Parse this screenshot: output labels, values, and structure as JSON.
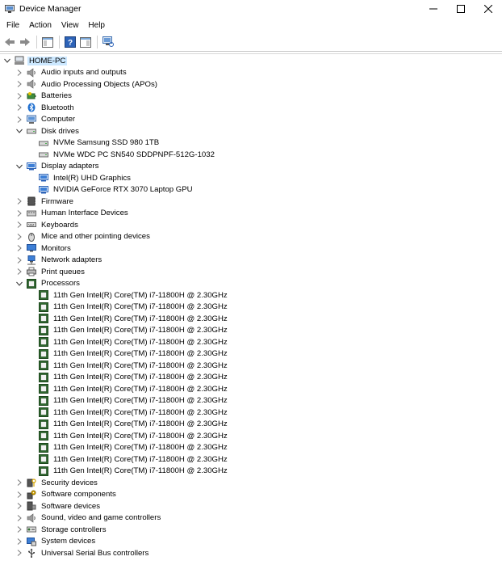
{
  "window": {
    "title": "Device Manager"
  },
  "menu": [
    "File",
    "Action",
    "View",
    "Help"
  ],
  "tree": {
    "root": "HOME-PC",
    "categories": [
      {
        "label": "Audio inputs and outputs",
        "icon": "speaker-icon",
        "expanded": false
      },
      {
        "label": "Audio Processing Objects (APOs)",
        "icon": "speaker-icon",
        "expanded": false
      },
      {
        "label": "Batteries",
        "icon": "battery-icon",
        "expanded": false
      },
      {
        "label": "Bluetooth",
        "icon": "bluetooth-icon",
        "expanded": false
      },
      {
        "label": "Computer",
        "icon": "computer-icon",
        "expanded": false
      },
      {
        "label": "Disk drives",
        "icon": "disk-drive-icon",
        "expanded": true,
        "children": [
          "NVMe Samsung SSD 980 1TB",
          "NVMe WDC PC SN540 SDDPNPF-512G-1032"
        ],
        "child_icon": "disk-drive-icon"
      },
      {
        "label": "Display adapters",
        "icon": "display-adapter-icon",
        "expanded": true,
        "children": [
          "Intel(R) UHD Graphics",
          "NVIDIA GeForce RTX 3070 Laptop GPU"
        ],
        "child_icon": "display-adapter-icon"
      },
      {
        "label": "Firmware",
        "icon": "firmware-icon",
        "expanded": false
      },
      {
        "label": "Human Interface Devices",
        "icon": "hid-icon",
        "expanded": false
      },
      {
        "label": "Keyboards",
        "icon": "keyboard-icon",
        "expanded": false
      },
      {
        "label": "Mice and other pointing devices",
        "icon": "mouse-icon",
        "expanded": false
      },
      {
        "label": "Monitors",
        "icon": "monitor-icon",
        "expanded": false
      },
      {
        "label": "Network adapters",
        "icon": "network-icon",
        "expanded": false
      },
      {
        "label": "Print queues",
        "icon": "printer-icon",
        "expanded": false
      },
      {
        "label": "Processors",
        "icon": "processor-icon",
        "expanded": true,
        "children": [
          "11th Gen Intel(R) Core(TM) i7-11800H @ 2.30GHz",
          "11th Gen Intel(R) Core(TM) i7-11800H @ 2.30GHz",
          "11th Gen Intel(R) Core(TM) i7-11800H @ 2.30GHz",
          "11th Gen Intel(R) Core(TM) i7-11800H @ 2.30GHz",
          "11th Gen Intel(R) Core(TM) i7-11800H @ 2.30GHz",
          "11th Gen Intel(R) Core(TM) i7-11800H @ 2.30GHz",
          "11th Gen Intel(R) Core(TM) i7-11800H @ 2.30GHz",
          "11th Gen Intel(R) Core(TM) i7-11800H @ 2.30GHz",
          "11th Gen Intel(R) Core(TM) i7-11800H @ 2.30GHz",
          "11th Gen Intel(R) Core(TM) i7-11800H @ 2.30GHz",
          "11th Gen Intel(R) Core(TM) i7-11800H @ 2.30GHz",
          "11th Gen Intel(R) Core(TM) i7-11800H @ 2.30GHz",
          "11th Gen Intel(R) Core(TM) i7-11800H @ 2.30GHz",
          "11th Gen Intel(R) Core(TM) i7-11800H @ 2.30GHz",
          "11th Gen Intel(R) Core(TM) i7-11800H @ 2.30GHz",
          "11th Gen Intel(R) Core(TM) i7-11800H @ 2.30GHz"
        ],
        "child_icon": "processor-icon"
      },
      {
        "label": "Security devices",
        "icon": "security-icon",
        "expanded": false
      },
      {
        "label": "Software components",
        "icon": "software-component-icon",
        "expanded": false
      },
      {
        "label": "Software devices",
        "icon": "software-device-icon",
        "expanded": false
      },
      {
        "label": "Sound, video and game controllers",
        "icon": "speaker-icon",
        "expanded": false
      },
      {
        "label": "Storage controllers",
        "icon": "storage-icon",
        "expanded": false
      },
      {
        "label": "System devices",
        "icon": "system-icon",
        "expanded": false
      },
      {
        "label": "Universal Serial Bus controllers",
        "icon": "usb-icon",
        "expanded": false
      }
    ]
  },
  "colors": {
    "selection": "#cce8ff",
    "processor_green": "#2f6b2f",
    "accent_blue": "#1f6fcf"
  }
}
